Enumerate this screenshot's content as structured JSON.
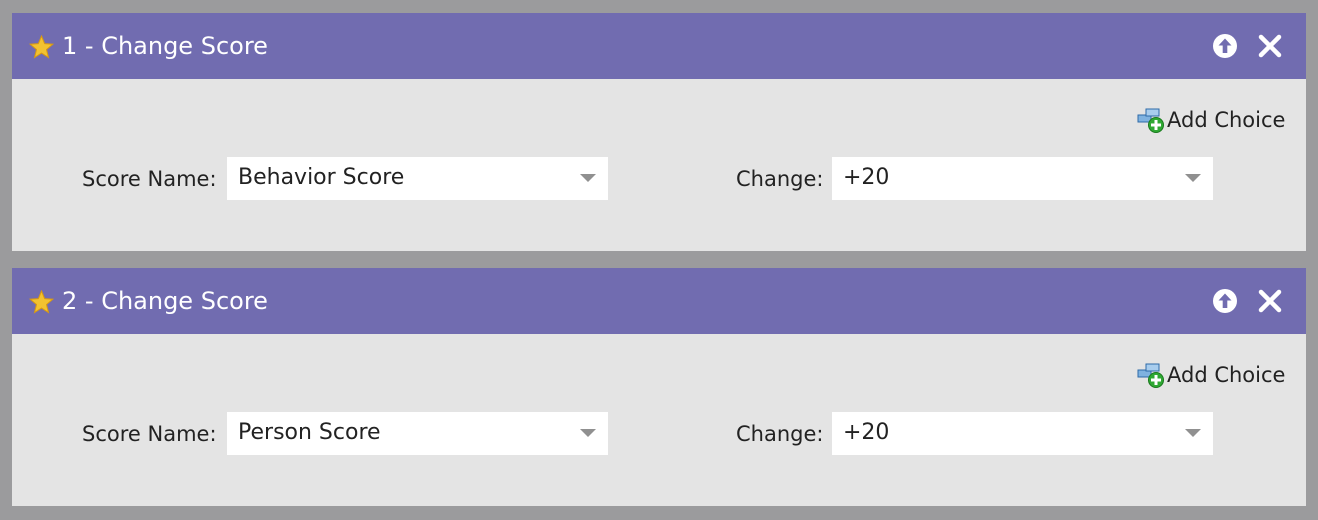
{
  "steps": [
    {
      "title": "1 - Change Score",
      "add_choice_label": "Add Choice",
      "score_name_label": "Score Name:",
      "score_name_value": "Behavior Score",
      "change_label": "Change:",
      "change_value": "+20"
    },
    {
      "title": "2 - Change Score",
      "add_choice_label": "Add Choice",
      "score_name_label": "Score Name:",
      "score_name_value": "Person Score",
      "change_label": "Change:",
      "change_value": "+20"
    }
  ],
  "icons": {
    "header_left": "star-icon",
    "move_up": "arrow-up-circle-icon",
    "delete": "close-icon",
    "add_choice": "add-choice-icon",
    "dropdown": "chevron-down-icon"
  },
  "colors": {
    "page_background": "#9b9b9d",
    "header_background": "#716cb0",
    "body_background": "#e4e4e4",
    "select_background": "#ffffff",
    "header_text": "#ffffff",
    "star": "#f2c230"
  }
}
